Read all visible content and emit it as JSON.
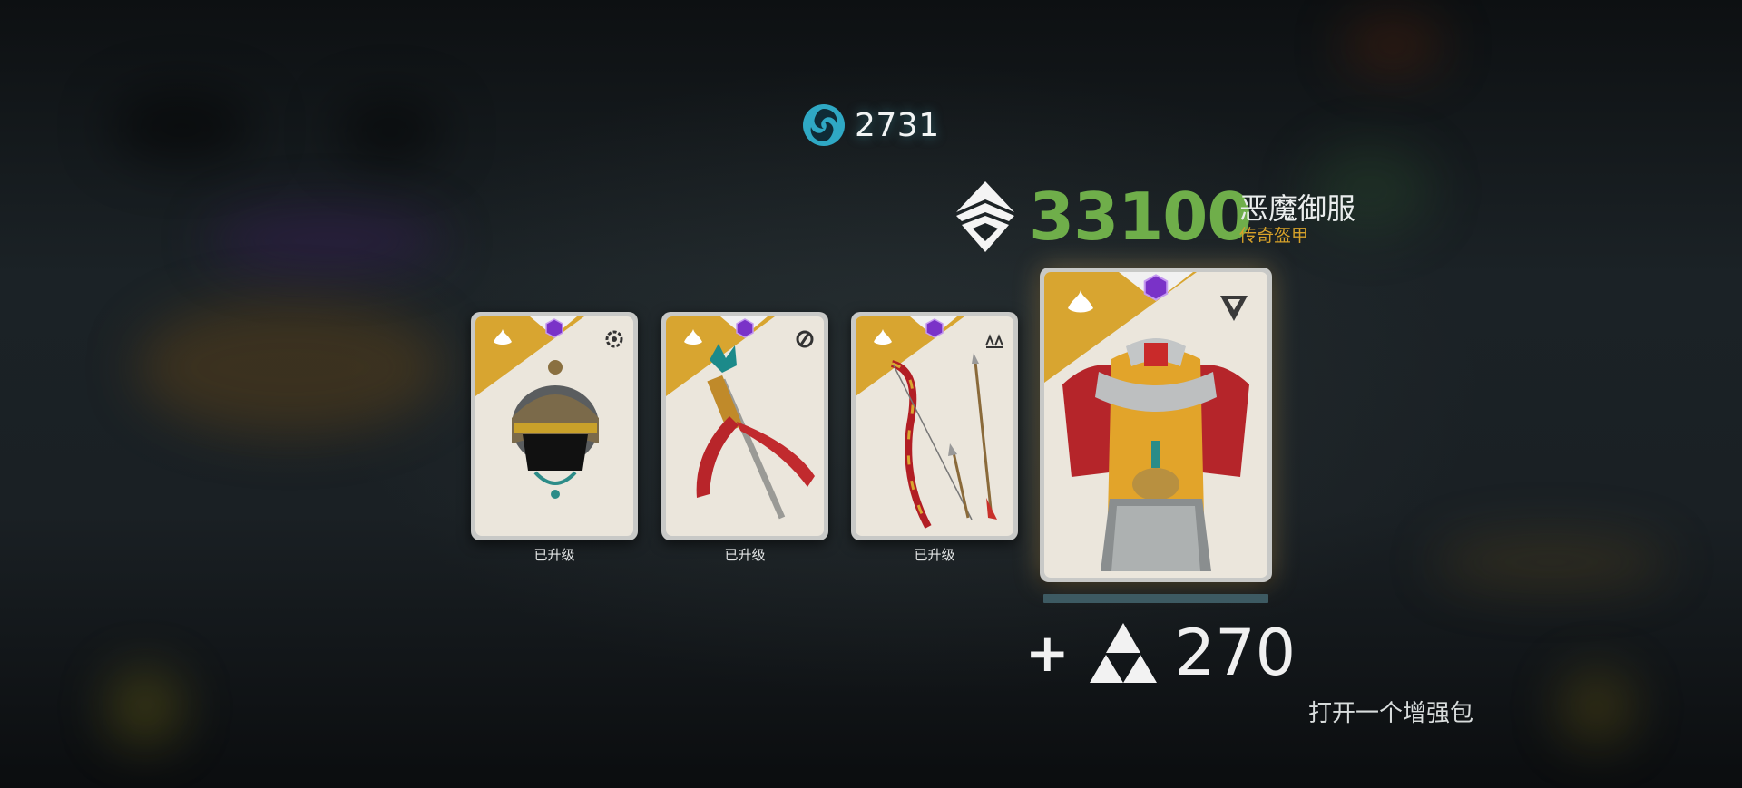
{
  "currency": {
    "icon": "swirl-orb-icon",
    "value": "2731",
    "color": "#2fa8c4"
  },
  "score": {
    "icon": "diamond-emblem-icon",
    "value": "33100",
    "color": "#6fae4a"
  },
  "item": {
    "name": "恶魔御服",
    "type": "传奇盔甲",
    "type_color": "#d6a12a"
  },
  "cards": [
    {
      "name": "helmet",
      "icon": "helmet-icon",
      "class_icon": "gear-ring-icon",
      "rarity_gem": "purple-gem-icon",
      "label": "已升级"
    },
    {
      "name": "staff",
      "icon": "ribbon-staff-icon",
      "class_icon": "yin-crescent-icon",
      "rarity_gem": "purple-gem-icon",
      "label": "已升级"
    },
    {
      "name": "bow",
      "icon": "bow-and-arrows-icon",
      "class_icon": "triple-peak-icon",
      "rarity_gem": "purple-gem-icon",
      "label": "已升级"
    },
    {
      "name": "armor",
      "icon": "chest-armor-icon",
      "class_icon": "arrowhead-icon",
      "rarity_gem": "purple-gem-icon",
      "label": ""
    }
  ],
  "reward": {
    "plus": "+",
    "icon": "triforce-icon",
    "value": "270"
  },
  "action": {
    "open_pack": "打开一个增强包"
  },
  "colors": {
    "card_gold": "#d8a530",
    "card_paper": "#ebe6dc",
    "progress": "#3d5a62"
  }
}
